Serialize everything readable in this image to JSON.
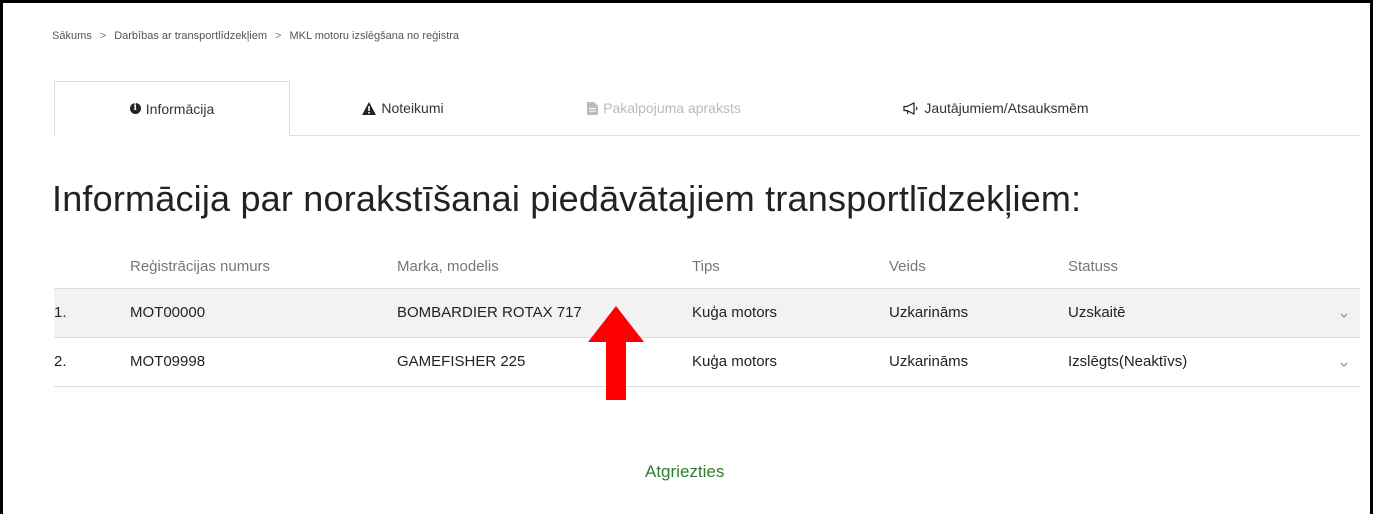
{
  "breadcrumb": {
    "items": [
      "Sākums",
      "Darbības ar transportlīdzekļiem",
      "MKL motoru izslēgšana no reģistra"
    ],
    "separator": ">"
  },
  "tabs": [
    {
      "label": "Informācija",
      "icon": "info-circle-icon",
      "state": "active"
    },
    {
      "label": "Noteikumi",
      "icon": "warning-triangle-icon",
      "state": "normal"
    },
    {
      "label": "Pakalpojuma apraksts",
      "icon": "document-icon",
      "state": "disabled"
    },
    {
      "label": "Jautājumiem/Atsauksmēm",
      "icon": "megaphone-icon",
      "state": "normal"
    }
  ],
  "page_title": "Informācija par norakstīšanai piedāvātajiem transportlīdzekļiem:",
  "table": {
    "columns": [
      "Reģistrācijas numurs",
      "Marka, modelis",
      "Tips",
      "Veids",
      "Statuss"
    ],
    "rows": [
      {
        "num": "1.",
        "reg": "MOT00000",
        "mark": "BOMBARDIER ROTAX 717",
        "tips": "Kuģa motors",
        "veids": "Uzkarināms",
        "status": "Uzskaitē"
      },
      {
        "num": "2.",
        "reg": "MOT09998",
        "mark": "GAMEFISHER 225",
        "tips": "Kuģa motors",
        "veids": "Uzkarināms",
        "status": "Izslēgts(Neaktīvs)"
      }
    ]
  },
  "back_link": "Atgriezties",
  "colors": {
    "link_green": "#2e7d32",
    "annotation_arrow": "#ff0000"
  }
}
